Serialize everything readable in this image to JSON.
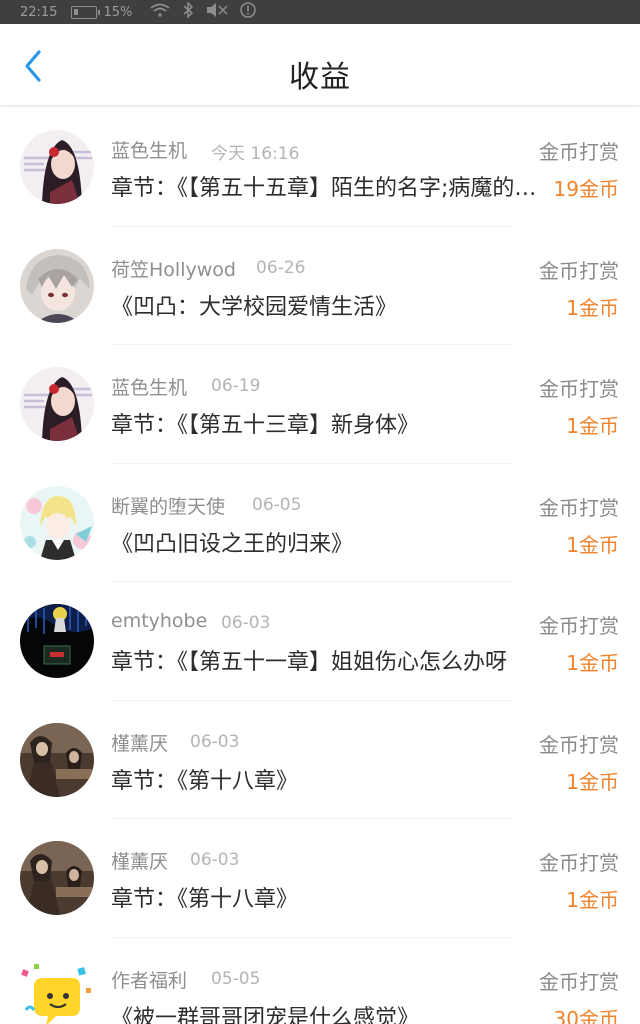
{
  "status_bar": {
    "time": "22:15",
    "battery": "15%",
    "icons": [
      "wifi-icon",
      "bluetooth-icon",
      "mute-icon",
      "alert-icon"
    ]
  },
  "header": {
    "title": "收益",
    "back_icon": "chevron-left-icon",
    "accent_color": "#2a97e8"
  },
  "colors": {
    "amount": "#f0832b",
    "muted": "#8f8f8f",
    "text": "#2d2d2d"
  },
  "items": [
    {
      "user": "蓝色生机",
      "date": "今天 16:16",
      "content": "章节：《【第五十五章】陌生的名字;病魔的折磨",
      "type": "金币打赏",
      "amount": "19金币",
      "avatar": "anime-girl-avatar"
    },
    {
      "user": "荷笠Hollywod",
      "date": "06-26",
      "content": "《凹凸：大学校园爱情生活》",
      "type": "金币打赏",
      "amount": "1金币",
      "avatar": "anime-boy-avatar"
    },
    {
      "user": "蓝色生机",
      "date": "06-19",
      "content": "章节：《【第五十三章】新身体》",
      "type": "金币打赏",
      "amount": "1金币",
      "avatar": "anime-girl-avatar"
    },
    {
      "user": "断翼的堕天使",
      "date": "06-05",
      "content": "《凹凸旧设之王的归来》",
      "type": "金币打赏",
      "amount": "1金币",
      "avatar": "anime-blonde-avatar"
    },
    {
      "user": "emtyhobe",
      "date": "06-03",
      "content": "章节：《【第五十一章】姐姐伤心怎么办呀",
      "type": "金币打赏",
      "amount": "1金币",
      "avatar": "dark-scene-avatar"
    },
    {
      "user": "槿薰厌",
      "date": "06-03",
      "content": "章节：《第十八章》",
      "type": "金币打赏",
      "amount": "1金币",
      "avatar": "sepia-scene-avatar"
    },
    {
      "user": "槿薰厌",
      "date": "06-03",
      "content": "章节：《第十八章》",
      "type": "金币打赏",
      "amount": "1金币",
      "avatar": "sepia-scene-avatar"
    },
    {
      "user": "作者福利",
      "date": "05-05",
      "content": "《被一群哥哥团宠是什么感觉》",
      "type": "金币打赏",
      "amount": "30金币",
      "avatar": "chat-bubble-avatar"
    }
  ]
}
